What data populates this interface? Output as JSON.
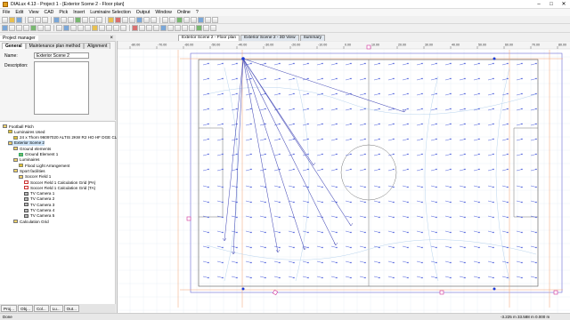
{
  "app": {
    "title": "DIALux 4.13 - Project 1 - [Exterior Scene 2 - Floor plan]"
  },
  "menu": [
    "File",
    "Edit",
    "View",
    "CAD",
    "Pick",
    "Insert",
    "Luminaire Selection",
    "Output",
    "Window",
    "Online",
    "?"
  ],
  "left_tabs": {
    "label": "Project manager"
  },
  "properties": {
    "tabs": [
      "General",
      "Maintenance plan method",
      "Alignment"
    ],
    "name_label": "Name:",
    "name_value": "Exterior Scene 2",
    "desc_label": "Description:"
  },
  "tree": [
    {
      "label": "Football Pitch",
      "indent": 0,
      "icon": "folder"
    },
    {
      "label": "Luminaires Used",
      "indent": 1,
      "icon": "lum"
    },
    {
      "label": "24 x Thorn 96097020 ALTIS 2KW R2 HO HF DGE CL1",
      "indent": 2,
      "icon": "lum"
    },
    {
      "label": "Exterior Scene 2",
      "indent": 1,
      "icon": "folder",
      "selected": true
    },
    {
      "label": "Ground elements",
      "indent": 2,
      "icon": "folder"
    },
    {
      "label": "Ground Element 1",
      "indent": 3,
      "icon": "ground"
    },
    {
      "label": "Luminaires",
      "indent": 2,
      "icon": "folder"
    },
    {
      "label": "Flood Light Arrangement",
      "indent": 3,
      "icon": "lum"
    },
    {
      "label": "Sport facilities",
      "indent": 2,
      "icon": "folder"
    },
    {
      "label": "Soccer Field 1",
      "indent": 3,
      "icon": "folder"
    },
    {
      "label": "Soccer Field 1 Calculation Grid (PA)",
      "indent": 4,
      "icon": "grid"
    },
    {
      "label": "Soccer Field 1 Calculation Grid (TA)",
      "indent": 4,
      "icon": "grid"
    },
    {
      "label": "TV Camera 1",
      "indent": 4,
      "icon": "cam"
    },
    {
      "label": "TV Camera 2",
      "indent": 4,
      "icon": "cam"
    },
    {
      "label": "TV Camera 3",
      "indent": 4,
      "icon": "cam"
    },
    {
      "label": "TV Camera 4",
      "indent": 4,
      "icon": "cam"
    },
    {
      "label": "TV Camera 5",
      "indent": 4,
      "icon": "cam"
    },
    {
      "label": "Calculation Grid",
      "indent": 2,
      "icon": "folder"
    }
  ],
  "bottom_tabs": [
    "Proj...",
    "Obj...",
    "Col...",
    "Lu...",
    "Out..."
  ],
  "doc_tabs": [
    "Exterior Scene 2 - Floor plan",
    "Exterior Scene 2 - 3D View",
    "Summary"
  ],
  "ruler_labels": [
    "-80.00",
    "-70.00",
    "-60.00",
    "-50.00",
    "-40.00",
    "-30.00",
    "-20.00",
    "-10.00",
    "0.00",
    "10.00",
    "20.00",
    "30.00",
    "40.00",
    "50.00",
    "60.00",
    "70.00",
    "80.00"
  ],
  "status": {
    "left": "Done",
    "coords": "-3.225 m   33.588 m    0.000 m"
  }
}
